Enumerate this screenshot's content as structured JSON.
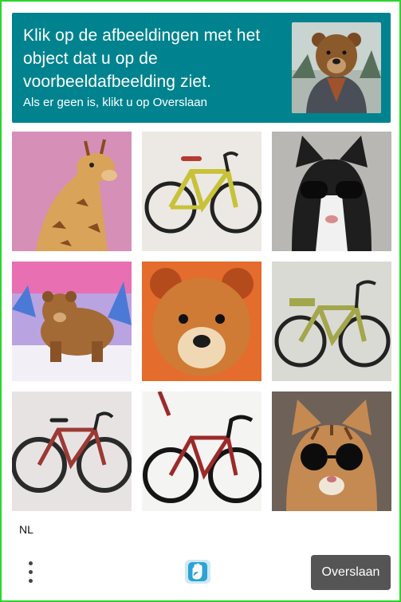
{
  "header": {
    "title": "Klik op de afbeeldingen met het object dat u op de voorbeeldafbeelding ziet.",
    "subtitle": "Als er geen is, klikt u op Overslaan",
    "example_image": "bear-in-jacket-image"
  },
  "grid": {
    "tiles": [
      {
        "subject": "giraffe"
      },
      {
        "subject": "bicycle"
      },
      {
        "subject": "cat-with-sunglasses"
      },
      {
        "subject": "bear"
      },
      {
        "subject": "bear-face"
      },
      {
        "subject": "bicycle"
      },
      {
        "subject": "bicycle"
      },
      {
        "subject": "bicycle"
      },
      {
        "subject": "cat-with-sunglasses"
      }
    ]
  },
  "footer": {
    "language": "NL",
    "skip_label": "Overslaan",
    "more_icon": "vertical-dots-icon",
    "logo_icon": "hand-logo-icon"
  },
  "colors": {
    "header_bg": "#00838f",
    "frame_border": "#2bd62b",
    "skip_bg": "#555555"
  }
}
